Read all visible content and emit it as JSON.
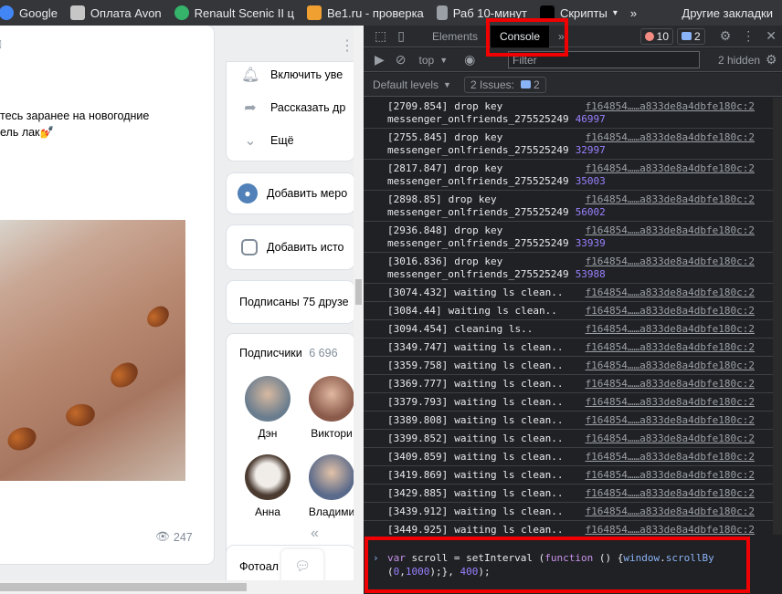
{
  "bookmarks": [
    {
      "label": "Google",
      "icon": "google-icon",
      "color": "#4285f4"
    },
    {
      "label": "Оплата Avon",
      "icon": "avon-icon",
      "color": "#c6c6c6"
    },
    {
      "label": "Renault Scenic II ц",
      "icon": "drive2-icon",
      "color": "#35b36b"
    },
    {
      "label": "Be1.ru - проверка",
      "icon": "be1-icon",
      "color": "#f0a030"
    },
    {
      "label": "Раб 10-минут",
      "icon": "page-icon",
      "color": "#9aa0a6"
    },
    {
      "label": "Скрипты",
      "icon": "folder-icon",
      "color": "#000000"
    }
  ],
  "bookmarks_more": "»",
  "bookmarks_other": "Другие закладки",
  "vk": {
    "post_text_line1": "тесь заранее на новогодние",
    "post_text_line2": "ель лак💅",
    "views": "247",
    "menu": [
      {
        "label": "Включить уве",
        "icon": "bell-icon"
      },
      {
        "label": "Рассказать др",
        "icon": "share-icon"
      },
      {
        "label": "Ещё",
        "icon": "chevron-down-icon"
      }
    ],
    "add_event": "Добавить меро",
    "add_story": "Добавить исто",
    "friends_subscribed": "Подписаны 75 друзе",
    "subscribers_title": "Подписчики",
    "subscribers_count": "6 696",
    "subscribers": [
      {
        "name": "Дэн",
        "color": "#6a7d8e"
      },
      {
        "name": "Виктори",
        "color": "#8a5a4a"
      },
      {
        "name": "Анна",
        "color": "#4a3a30"
      },
      {
        "name": "Владими",
        "color": "#5a6a8a"
      }
    ],
    "albums": "Фотоал"
  },
  "devtools": {
    "tabs": {
      "elements": "Elements",
      "console": "Console",
      "more": "»"
    },
    "errors_count": "10",
    "issues_count_top": "2",
    "context": "top",
    "filter_placeholder": "Filter",
    "hidden": "2 hidden",
    "default_levels": "Default levels",
    "issues_label": "2 Issues:",
    "issues_count": "2",
    "source": "f164854……a833de8a4dbfe180c:2",
    "logs": [
      {
        "ts": "[2709.854]",
        "text": "drop key",
        "key": "messenger_onlfriends_275525249",
        "num": "46997"
      },
      {
        "ts": "[2755.845]",
        "text": "drop key",
        "key": "messenger_onlfriends_275525249",
        "num": "32997"
      },
      {
        "ts": "[2817.847]",
        "text": "drop key",
        "key": "messenger_onlfriends_275525249",
        "num": "35003"
      },
      {
        "ts": "[2898.85]",
        "text": "drop key",
        "key": "messenger_onlfriends_275525249",
        "num": "56002"
      },
      {
        "ts": "[2936.848]",
        "text": "drop key",
        "key": "messenger_onlfriends_275525249",
        "num": "33939"
      },
      {
        "ts": "[3016.836]",
        "text": "drop key",
        "key": "messenger_onlfriends_275525249",
        "num": "53988"
      },
      {
        "ts": "[3074.432]",
        "text": "waiting ls clean..",
        "key": "",
        "num": ""
      },
      {
        "ts": "[3084.44]",
        "text": "waiting ls clean..",
        "key": "",
        "num": ""
      },
      {
        "ts": "[3094.454]",
        "text": "cleaning ls..",
        "key": "",
        "num": ""
      },
      {
        "ts": "[3349.747]",
        "text": "waiting ls clean..",
        "key": "",
        "num": ""
      },
      {
        "ts": "[3359.758]",
        "text": "waiting ls clean..",
        "key": "",
        "num": ""
      },
      {
        "ts": "[3369.777]",
        "text": "waiting ls clean..",
        "key": "",
        "num": ""
      },
      {
        "ts": "[3379.793]",
        "text": "waiting ls clean..",
        "key": "",
        "num": ""
      },
      {
        "ts": "[3389.808]",
        "text": "waiting ls clean..",
        "key": "",
        "num": ""
      },
      {
        "ts": "[3399.852]",
        "text": "waiting ls clean..",
        "key": "",
        "num": ""
      },
      {
        "ts": "[3409.859]",
        "text": "waiting ls clean..",
        "key": "",
        "num": ""
      },
      {
        "ts": "[3419.869]",
        "text": "waiting ls clean..",
        "key": "",
        "num": ""
      },
      {
        "ts": "[3429.885]",
        "text": "waiting ls clean..",
        "key": "",
        "num": ""
      },
      {
        "ts": "[3439.912]",
        "text": "waiting ls clean..",
        "key": "",
        "num": ""
      },
      {
        "ts": "[3449.925]",
        "text": "waiting ls clean..",
        "key": "",
        "num": ""
      }
    ],
    "input": {
      "kw_var": "var",
      "name": "scroll",
      "eq": "=",
      "fn_name": "setInterval",
      "open": "(",
      "kw_function": "function",
      "body_open": "() {",
      "obj": "window",
      "dot": ".",
      "method": "scrollBy",
      "arg_open": "(",
      "arg_x": "0",
      "comma": ",",
      "arg_y": "1000",
      "arg_close": ");},",
      "interval": "400",
      "end": ");"
    }
  },
  "highlight_color": "#f00000"
}
